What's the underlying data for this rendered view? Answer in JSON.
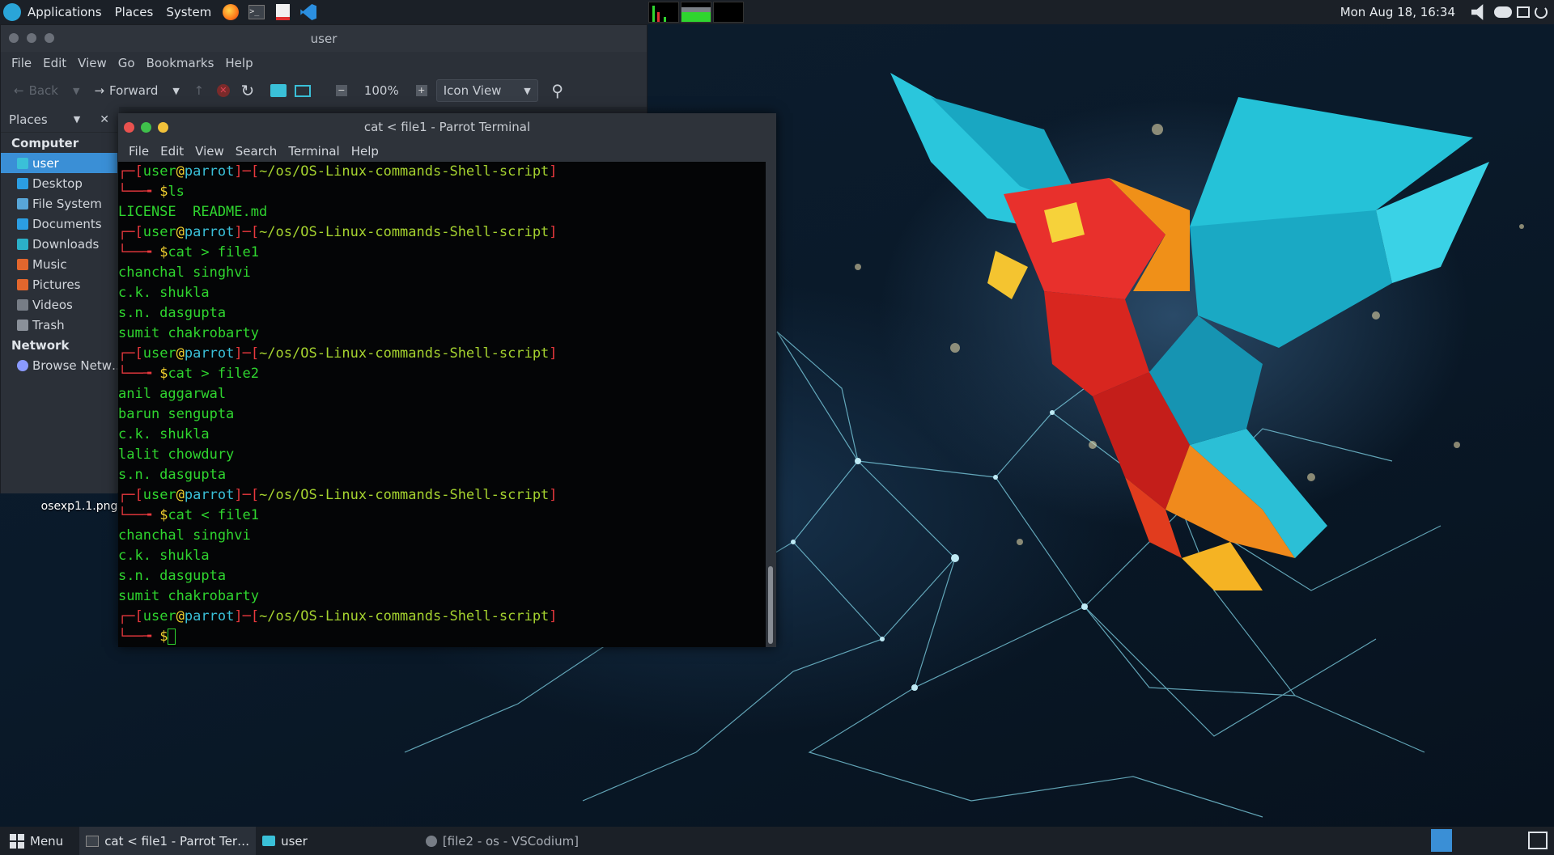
{
  "top_panel": {
    "applications": "Applications",
    "places": "Places",
    "system": "System",
    "clock": "Mon Aug 18, 16:34"
  },
  "file_manager": {
    "title": "user",
    "menu": [
      "File",
      "Edit",
      "View",
      "Go",
      "Bookmarks",
      "Help"
    ],
    "toolbar": {
      "back": "Back",
      "forward": "Forward",
      "zoom": "100%",
      "view_mode": "Icon View"
    },
    "sidebar": {
      "header": "Places",
      "computer_heading": "Computer",
      "network_heading": "Network",
      "items": [
        {
          "label": "user",
          "color": "#3ac0d8"
        },
        {
          "label": "Desktop",
          "color": "#2b9ee3"
        },
        {
          "label": "File System",
          "color": "#58a6d8"
        },
        {
          "label": "Documents",
          "color": "#2b9ee3"
        },
        {
          "label": "Downloads",
          "color": "#2bb0c8"
        },
        {
          "label": "Music",
          "color": "#e2662d"
        },
        {
          "label": "Pictures",
          "color": "#e2662d"
        },
        {
          "label": "Videos",
          "color": "#777d86"
        },
        {
          "label": "Trash",
          "color": "#8a9099"
        }
      ],
      "network_items": [
        {
          "label": "Browse Netw…",
          "color": "#8a9aff"
        }
      ]
    }
  },
  "terminal": {
    "title": "cat < file1 - Parrot Terminal",
    "menu": [
      "File",
      "Edit",
      "View",
      "Search",
      "Terminal",
      "Help"
    ],
    "prompt": {
      "user": "user",
      "at": "@",
      "host": "parrot",
      "path": "~/os/OS-Linux-commands-Shell-script"
    },
    "blocks": [
      {
        "command": "ls",
        "output": [
          "LICENSE  README.md"
        ]
      },
      {
        "command": "cat > file1",
        "output": [
          "chanchal singhvi",
          "c.k. shukla",
          "s.n. dasgupta",
          "sumit chakrobarty"
        ]
      },
      {
        "command": "cat > file2",
        "output": [
          "anil aggarwal",
          "barun sengupta",
          "c.k. shukla",
          "lalit chowdury",
          "s.n. dasgupta"
        ]
      },
      {
        "command": "cat < file1",
        "output": [
          "chanchal singhvi",
          "c.k. shukla",
          "s.n. dasgupta",
          "sumit chakrobarty"
        ]
      }
    ]
  },
  "desktop_file": "osexp1.1.png",
  "bottom_panel": {
    "menu": "Menu",
    "tasks": [
      {
        "label": "cat < file1 - Parrot Ter…",
        "active": true
      },
      {
        "label": "user",
        "active": false
      },
      {
        "label": "[file2 - os - VSCodium]",
        "active": false
      }
    ]
  }
}
